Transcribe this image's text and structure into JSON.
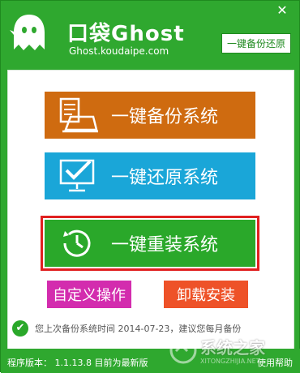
{
  "header": {
    "app_title": "口袋Ghost",
    "app_url": "Ghost.koudaipe.com",
    "close_symbol": "✕",
    "top_link": "一键备份还原"
  },
  "buttons": {
    "backup": "一键备份系统",
    "restore": "一键还原系统",
    "reinstall": "一键重装系统",
    "custom": "自定义操作",
    "uninstall": "卸载安装"
  },
  "status": {
    "message": "您上次备份系统时间 2014-07-23，建议您每月备份"
  },
  "footer": {
    "version": "程序版本： 1.1.13.8 目前为最新版",
    "help": "使用帮助"
  },
  "watermark": {
    "text": "系统之家",
    "url": "XITONGZHIJIA.NET"
  },
  "icons": {
    "ghost": "ghost-logo-icon",
    "backup": "document-laptop-icon",
    "restore": "monitor-check-icon",
    "reinstall": "clock-refresh-icon",
    "status": "check-circle-icon"
  },
  "colors": {
    "brand_green": "#2fa82f",
    "backup_orange": "#cf6b10",
    "restore_blue": "#1aa6d8",
    "reinstall_green": "#2aa82a",
    "highlight_red": "#e02020",
    "custom_magenta": "#d32cae",
    "uninstall_red": "#ee5228"
  }
}
